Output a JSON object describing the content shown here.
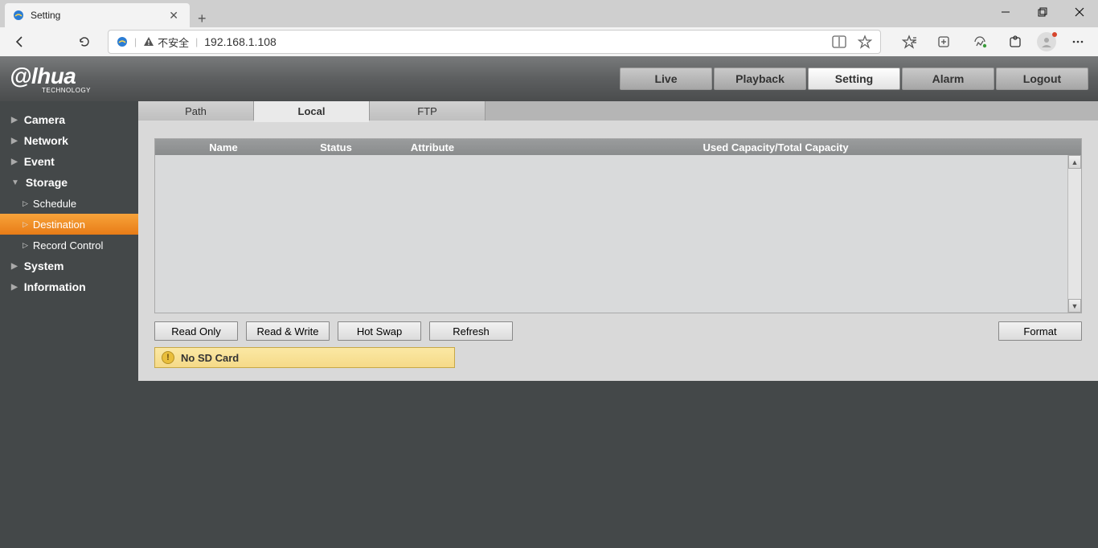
{
  "browser": {
    "tab_title": "Setting",
    "security_label": "不安全",
    "url": "192.168.1.108"
  },
  "logo": {
    "brand": "alhua",
    "sub": "TECHNOLOGY"
  },
  "top_nav": {
    "live": "Live",
    "playback": "Playback",
    "setting": "Setting",
    "alarm": "Alarm",
    "logout": "Logout"
  },
  "sidebar": {
    "camera": "Camera",
    "network": "Network",
    "event": "Event",
    "storage": "Storage",
    "storage_children": {
      "schedule": "Schedule",
      "destination": "Destination",
      "record_control": "Record Control"
    },
    "system": "System",
    "information": "Information"
  },
  "content_tabs": {
    "path": "Path",
    "local": "Local",
    "ftp": "FTP"
  },
  "table": {
    "headers": {
      "name": "Name",
      "status": "Status",
      "attribute": "Attribute",
      "capacity": "Used Capacity/Total Capacity"
    },
    "rows": []
  },
  "buttons": {
    "read_only": "Read Only",
    "read_write": "Read & Write",
    "hot_swap": "Hot Swap",
    "refresh": "Refresh",
    "format": "Format"
  },
  "message": {
    "text": "No SD Card"
  }
}
